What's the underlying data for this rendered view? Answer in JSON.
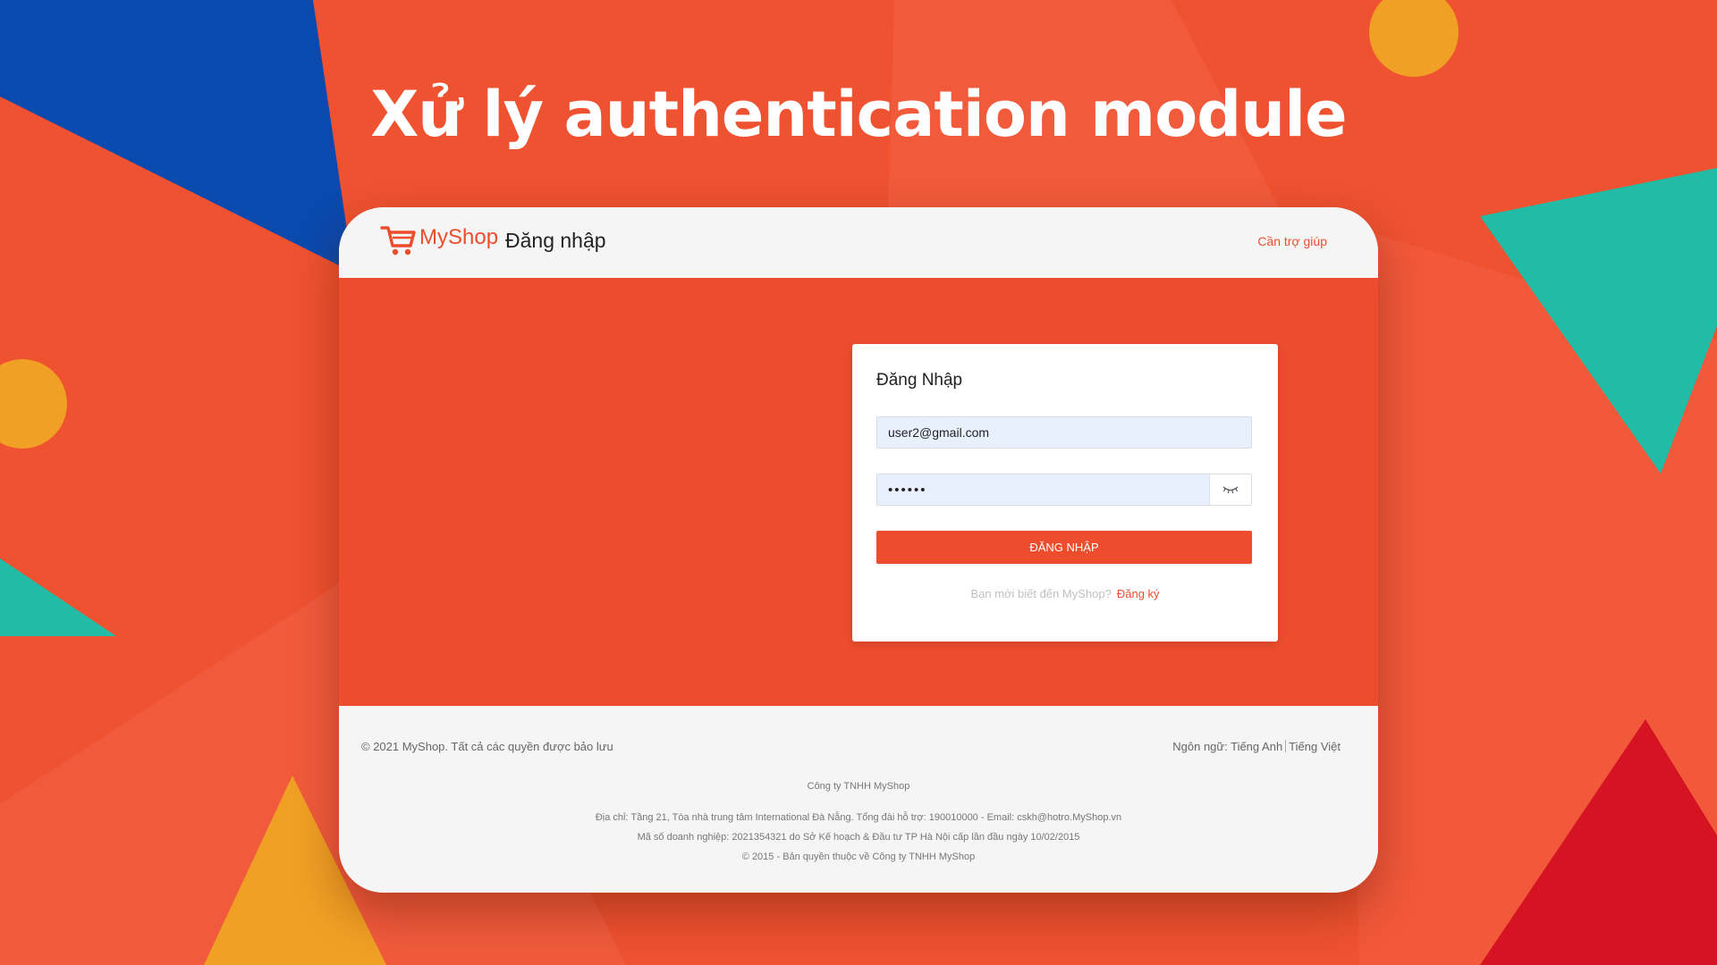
{
  "slide": {
    "title": "Xử lý authentication module"
  },
  "colors": {
    "background": "#ee5230",
    "accent": "#ee4d2d",
    "blue": "#0a49ad",
    "teal": "#22bca6",
    "yellow": "#f0a024",
    "red": "#d61323"
  },
  "header": {
    "brand": "MyShop",
    "title": "Đăng nhập",
    "help_link": "Cần trợ giúp",
    "logo_icon": "shopping-cart-icon"
  },
  "login_form": {
    "title": "Đăng Nhập",
    "email_value": "user2@gmail.com",
    "password_value": "••••••",
    "password_toggle_icon": "eye-closed-icon",
    "submit_label": "ĐĂNG NHẬP",
    "signup_prompt": "Bạn mới biết đến MyShop?",
    "signup_link": "Đăng ký"
  },
  "footer": {
    "copyright": "© 2021 MyShop. Tất cả các quyền được bảo lưu",
    "language_label": "Ngôn ngữ:",
    "languages": [
      "Tiếng Anh",
      "Tiếng Việt"
    ],
    "company": "Công ty TNHH MyShop",
    "address": "Địa chỉ: Tầng 21, Tòa nhà trung tâm International Đà Nẵng. Tổng đài hỗ trợ: 190010000 - Email: cskh@hotro.MyShop.vn",
    "business_id": "Mã số doanh nghiệp: 2021354321 do Sở Kế hoạch & Đầu tư TP Hà Nội cấp lần đầu ngày 10/02/2015",
    "rights": "© 2015 - Bản quyền thuộc về Công ty TNHH MyShop"
  }
}
